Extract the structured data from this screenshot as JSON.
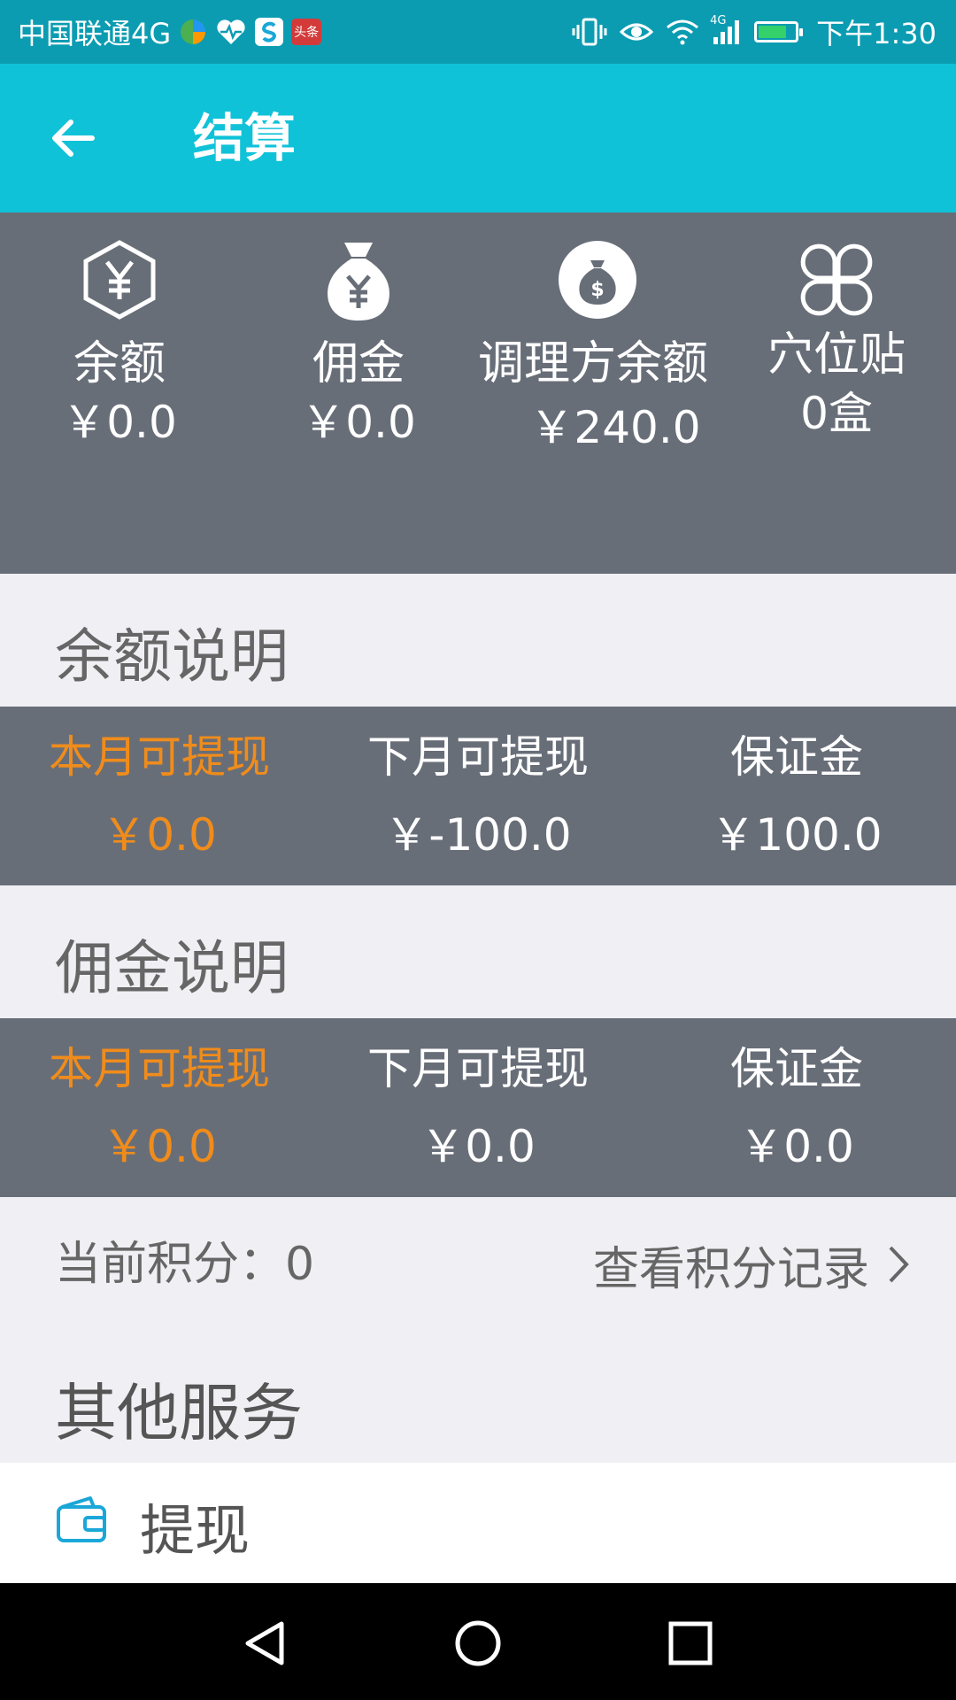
{
  "status_bar": {
    "carrier": "中国联通4G",
    "news_badge": "头条",
    "network": "4G",
    "time": "下午1:30",
    "icons": [
      "app-multicolor-icon",
      "heart-pulse-icon",
      "app-s-icon",
      "news-app-icon",
      "vibrate-icon",
      "eye-icon",
      "wifi-icon",
      "signal-icon",
      "battery-charging-icon"
    ]
  },
  "app_bar": {
    "title": "结算",
    "back_icon": "arrow-left-icon"
  },
  "summary": {
    "items": [
      {
        "label": "余额",
        "value": "￥0.0",
        "icon": "yuan-hexagon-icon"
      },
      {
        "label": "佣金",
        "value": "￥0.0",
        "icon": "money-bag-yuan-icon"
      },
      {
        "label": "调理方余额",
        "value": "￥240.0",
        "icon": "money-bag-dollar-icon"
      },
      {
        "label": "穴位贴",
        "value": "0盒",
        "icon": "four-petal-icon"
      }
    ]
  },
  "balance_section": {
    "title": "余额说明",
    "columns": [
      {
        "label": "本月可提现",
        "value": "￥0.0",
        "highlight": true
      },
      {
        "label": "下月可提现",
        "value": "￥-100.0",
        "highlight": false
      },
      {
        "label": "保证金",
        "value": "￥100.0",
        "highlight": false
      }
    ]
  },
  "commission_section": {
    "title": "佣金说明",
    "columns": [
      {
        "label": "本月可提现",
        "value": "￥0.0",
        "highlight": true
      },
      {
        "label": "下月可提现",
        "value": "￥0.0",
        "highlight": false
      },
      {
        "label": "保证金",
        "value": "￥0.0",
        "highlight": false
      }
    ]
  },
  "points": {
    "label": "当前积分：",
    "value": "0",
    "link": "查看积分记录"
  },
  "other_services": {
    "title": "其他服务",
    "items": [
      {
        "label": "提现",
        "icon": "wallet-icon"
      }
    ]
  },
  "colors": {
    "status_bar": "#0b9cb2",
    "app_bar": "#10c2d8",
    "panel": "#686e78",
    "highlight": "#f08c1b",
    "background": "#efeff4",
    "wallet_icon": "#1aa7d8"
  }
}
